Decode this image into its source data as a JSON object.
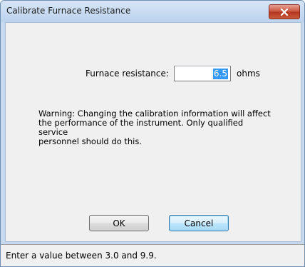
{
  "window": {
    "title": "Calibrate Furnace Resistance",
    "close_icon": "close-icon"
  },
  "form": {
    "label": "Furnace resistance:",
    "value": "6.5",
    "unit": "ohms"
  },
  "warning": {
    "lines": [
      "Warning: Changing the calibration information will affect",
      "the performance of the instrument. Only qualified service",
      "personnel should do this."
    ]
  },
  "buttons": {
    "ok": "OK",
    "cancel": "Cancel"
  },
  "status": {
    "text": "Enter a value between 3.0 and 9.9."
  },
  "colors": {
    "close_button": "#c9553f",
    "selection": "#3399ff",
    "frame": "#c7d9ef"
  }
}
